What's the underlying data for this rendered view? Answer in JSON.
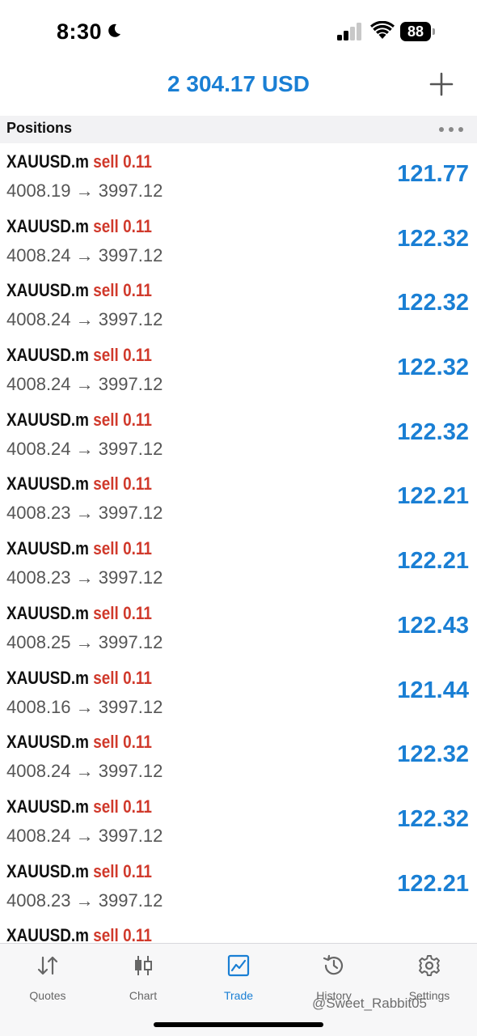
{
  "status_bar": {
    "time": "8:30",
    "battery": "88"
  },
  "header": {
    "balance": "2 304.17 USD"
  },
  "section": {
    "title": "Positions"
  },
  "positions": [
    {
      "symbol": "XAUUSD.m",
      "direction": "sell",
      "volume": "0.11",
      "open_price": "4008.19",
      "arrow": "→",
      "current_price": "3997.12",
      "profit": "121.77"
    },
    {
      "symbol": "XAUUSD.m",
      "direction": "sell",
      "volume": "0.11",
      "open_price": "4008.24",
      "arrow": "→",
      "current_price": "3997.12",
      "profit": "122.32"
    },
    {
      "symbol": "XAUUSD.m",
      "direction": "sell",
      "volume": "0.11",
      "open_price": "4008.24",
      "arrow": "→",
      "current_price": "3997.12",
      "profit": "122.32"
    },
    {
      "symbol": "XAUUSD.m",
      "direction": "sell",
      "volume": "0.11",
      "open_price": "4008.24",
      "arrow": "→",
      "current_price": "3997.12",
      "profit": "122.32"
    },
    {
      "symbol": "XAUUSD.m",
      "direction": "sell",
      "volume": "0.11",
      "open_price": "4008.24",
      "arrow": "→",
      "current_price": "3997.12",
      "profit": "122.32"
    },
    {
      "symbol": "XAUUSD.m",
      "direction": "sell",
      "volume": "0.11",
      "open_price": "4008.23",
      "arrow": "→",
      "current_price": "3997.12",
      "profit": "122.21"
    },
    {
      "symbol": "XAUUSD.m",
      "direction": "sell",
      "volume": "0.11",
      "open_price": "4008.23",
      "arrow": "→",
      "current_price": "3997.12",
      "profit": "122.21"
    },
    {
      "symbol": "XAUUSD.m",
      "direction": "sell",
      "volume": "0.11",
      "open_price": "4008.25",
      "arrow": "→",
      "current_price": "3997.12",
      "profit": "122.43"
    },
    {
      "symbol": "XAUUSD.m",
      "direction": "sell",
      "volume": "0.11",
      "open_price": "4008.16",
      "arrow": "→",
      "current_price": "3997.12",
      "profit": "121.44"
    },
    {
      "symbol": "XAUUSD.m",
      "direction": "sell",
      "volume": "0.11",
      "open_price": "4008.24",
      "arrow": "→",
      "current_price": "3997.12",
      "profit": "122.32"
    },
    {
      "symbol": "XAUUSD.m",
      "direction": "sell",
      "volume": "0.11",
      "open_price": "4008.24",
      "arrow": "→",
      "current_price": "3997.12",
      "profit": "122.32"
    },
    {
      "symbol": "XAUUSD.m",
      "direction": "sell",
      "volume": "0.11",
      "open_price": "4008.23",
      "arrow": "→",
      "current_price": "3997.12",
      "profit": "122.21"
    },
    {
      "symbol": "XAUUSD.m",
      "direction": "sell",
      "volume": "0.11",
      "open_price": "",
      "arrow": "",
      "current_price": "",
      "profit": ""
    }
  ],
  "tabs": [
    {
      "label": "Quotes",
      "icon": "quotes-arrows-icon",
      "active": false
    },
    {
      "label": "Chart",
      "icon": "candlestick-icon",
      "active": false
    },
    {
      "label": "Trade",
      "icon": "trade-chart-icon",
      "active": true
    },
    {
      "label": "History",
      "icon": "history-clock-icon",
      "active": false
    },
    {
      "label": "Settings",
      "icon": "gear-icon",
      "active": false
    }
  ],
  "watermark": "@Sweet_Rabbit05",
  "colors": {
    "accent": "#1a7fd4",
    "sell": "#d0392b",
    "section_bg": "#f2f2f4"
  }
}
